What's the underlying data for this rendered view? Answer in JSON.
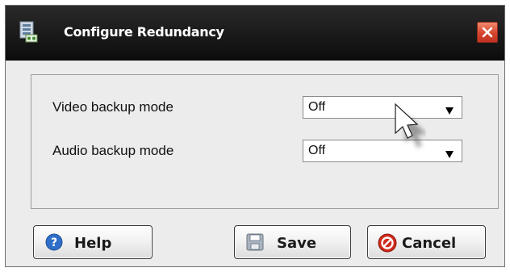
{
  "dialog": {
    "title": "Configure Redundancy",
    "title_icon": "network-config-icon",
    "close_icon": "close-icon"
  },
  "settings": {
    "video": {
      "label": "Video backup mode",
      "value": "Off"
    },
    "audio": {
      "label": "Audio backup mode",
      "value": "Off"
    }
  },
  "buttons": {
    "help": {
      "label": "Help",
      "icon": "help-icon"
    },
    "save": {
      "label": "Save",
      "icon": "save-icon"
    },
    "cancel": {
      "label": "Cancel",
      "icon": "cancel-icon"
    }
  },
  "colors": {
    "titlebar": "#111111",
    "close": "#d5442c",
    "help_icon": "#2f6fc9",
    "cancel_icon": "#d12a1c"
  }
}
